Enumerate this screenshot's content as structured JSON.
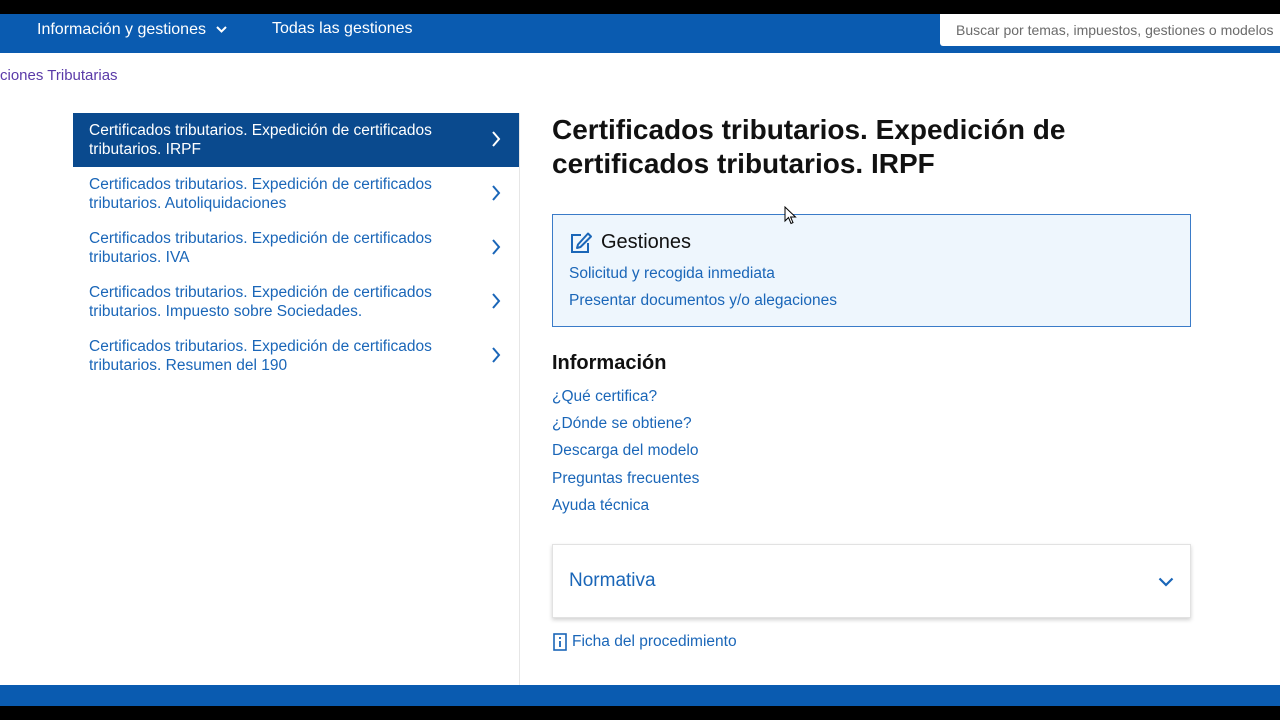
{
  "nav": {
    "info_label": "Información y gestiones",
    "all_label": "Todas las gestiones"
  },
  "search": {
    "placeholder": "Buscar por temas, impuestos, gestiones o modelos"
  },
  "breadcrumb": {
    "text": "ciones Tributarias"
  },
  "sidebar": {
    "items": [
      {
        "label": "Certificados tributarios. Expedición de certificados tributarios. IRPF",
        "active": true
      },
      {
        "label": "Certificados tributarios. Expedición de certificados tributarios. Autoliquidaciones"
      },
      {
        "label": "Certificados tributarios. Expedición de certificados tributarios. IVA"
      },
      {
        "label": "Certificados tributarios. Expedición de certificados tributarios. Impuesto sobre Sociedades."
      },
      {
        "label": "Certificados tributarios. Expedición de certificados tributarios. Resumen del 190"
      }
    ]
  },
  "main": {
    "title": "Certificados tributarios. Expedición de certificados tributarios. IRPF",
    "gestiones": {
      "heading": "Gestiones",
      "links": [
        "Solicitud y recogida inmediata",
        "Presentar documentos y/o alegaciones"
      ]
    },
    "informacion": {
      "heading": "Información",
      "links": [
        "¿Qué certifica?",
        "¿Dónde se obtiene?",
        "Descarga del modelo",
        "Preguntas frecuentes",
        "Ayuda técnica"
      ]
    },
    "normativa": {
      "heading": "Normativa"
    },
    "ficha": {
      "label": "Ficha del procedimiento"
    }
  },
  "icons": {
    "nav_caret": "chevron-down-icon",
    "side_chevron": "chevron-right-icon",
    "gestiones": "edit-icon",
    "normativa": "chevron-down-icon",
    "ficha": "document-info-icon"
  },
  "colors": {
    "brand_blue": "#0a5bb0",
    "active_item": "#0a4a8e",
    "link": "#1a66b8",
    "panel_bg": "#eef6fd",
    "breadcrumb": "#5a3aa8"
  }
}
